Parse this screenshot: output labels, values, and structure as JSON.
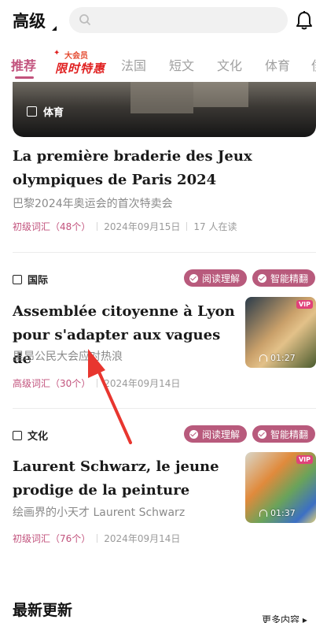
{
  "header": {
    "level_label": "高级",
    "search_placeholder": ""
  },
  "tabs": [
    {
      "label": "推荐",
      "active": true
    },
    {
      "label": "法国"
    },
    {
      "label": "短文"
    },
    {
      "label": "文化"
    },
    {
      "label": "体育"
    },
    {
      "label": "侈"
    }
  ],
  "promo": {
    "top": "大会员",
    "main": "限时特惠"
  },
  "feed": {
    "hero": {
      "category": "体育",
      "title_fr": "La première braderie des Jeux olympiques de Paris 2024",
      "title_cn": "巴黎2024年奥运会的首次特卖会",
      "level": "初级词汇（48个）",
      "date": "2024年09月15日",
      "readers": "17 人在读"
    },
    "articles": [
      {
        "category": "国际",
        "badges": [
          "阅读理解",
          "智能精翻"
        ],
        "title_fr": "Assemblée citoyenne à Lyon pour s'adapter aux vagues de",
        "title_cn": "里昂公民大会应对热浪",
        "level": "高级词汇（30个）",
        "date": "2024年09月14日",
        "vip": "VIP",
        "duration": "01:27"
      },
      {
        "category": "文化",
        "badges": [
          "阅读理解",
          "智能精翻"
        ],
        "title_fr": "Laurent Schwarz, le jeune prodige de la peinture",
        "title_cn": "绘画界的小天才 Laurent Schwarz",
        "level": "初级词汇（76个）",
        "date": "2024年09月14日",
        "vip": "VIP",
        "duration": "01:37"
      }
    ]
  },
  "latest": {
    "title": "最新更新",
    "more": "更多内容 ▸"
  },
  "colors": {
    "accent": "#c2537d",
    "badge": "#b85a7c",
    "promo": "#e02020"
  }
}
